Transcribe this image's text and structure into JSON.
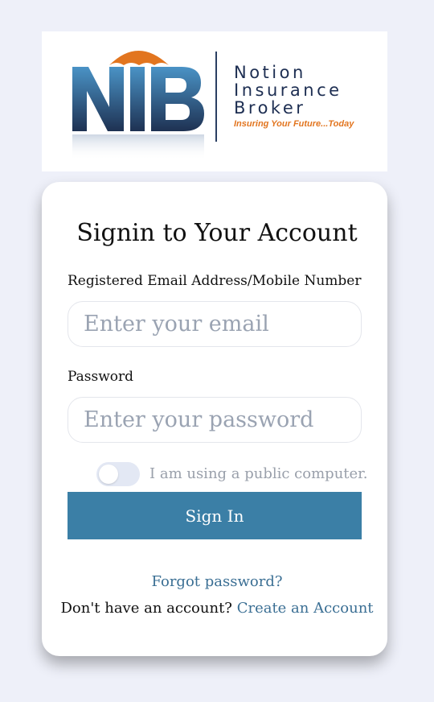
{
  "logo": {
    "mark": "NIB",
    "brand_line1": "Notion",
    "brand_line2": "Insurance",
    "brand_line3": "Broker",
    "tagline": "Insuring Your Future...Today",
    "colors": {
      "navy": "#1d2e52",
      "blue": "#3f86bd",
      "orange": "#e2751f"
    }
  },
  "form": {
    "title": "Signin to Your Account",
    "email_label": "Registered Email Address/Mobile Number",
    "email_placeholder": "Enter your email",
    "password_label": "Password",
    "password_placeholder": "Enter your password",
    "public_computer_label": "I am using a public computer.",
    "public_computer_on": false,
    "sign_in_label": "Sign In",
    "forgot_password_label": "Forgot password?",
    "no_account_text": "Don't have an account?",
    "create_account_label": "Create an Account"
  },
  "colors": {
    "background": "#eef0f9",
    "button": "#3b7fa6",
    "link": "#3b6f94"
  }
}
